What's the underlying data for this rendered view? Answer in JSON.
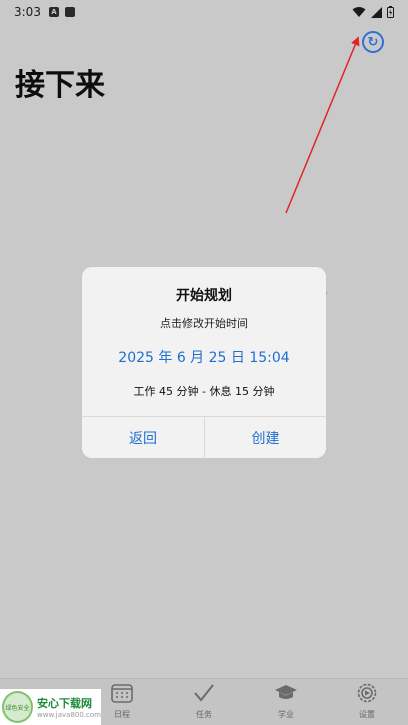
{
  "status_bar": {
    "time": "3:03",
    "left_icons": [
      "A",
      "card"
    ]
  },
  "header": {
    "title": "接下来",
    "refresh_icon": "refresh-icon"
  },
  "dialog": {
    "title": "开始规划",
    "subtitle": "点击修改开始时间",
    "datetime": "2025 年 6 月 25 日 15:04",
    "duration": "工作 45 分钟 - 休息 15 分钟",
    "back_label": "返回",
    "create_label": "创建"
  },
  "tabbar": {
    "tabs": [
      {
        "label": "日程",
        "icon": "calendar-icon"
      },
      {
        "label": "任务",
        "icon": "checkmark-icon"
      },
      {
        "label": "学业",
        "icon": "graduation-cap-icon"
      },
      {
        "label": "设置",
        "icon": "gear-icon"
      }
    ]
  },
  "watermark": {
    "brand": "安心下载网",
    "url": "www.java800.com",
    "logo_text": "绿色安全"
  },
  "colors": {
    "accent": "#1f6fd0",
    "background": "#c9c9ca",
    "dialog": "#f2f2f2",
    "annotation": "#e0242b"
  }
}
